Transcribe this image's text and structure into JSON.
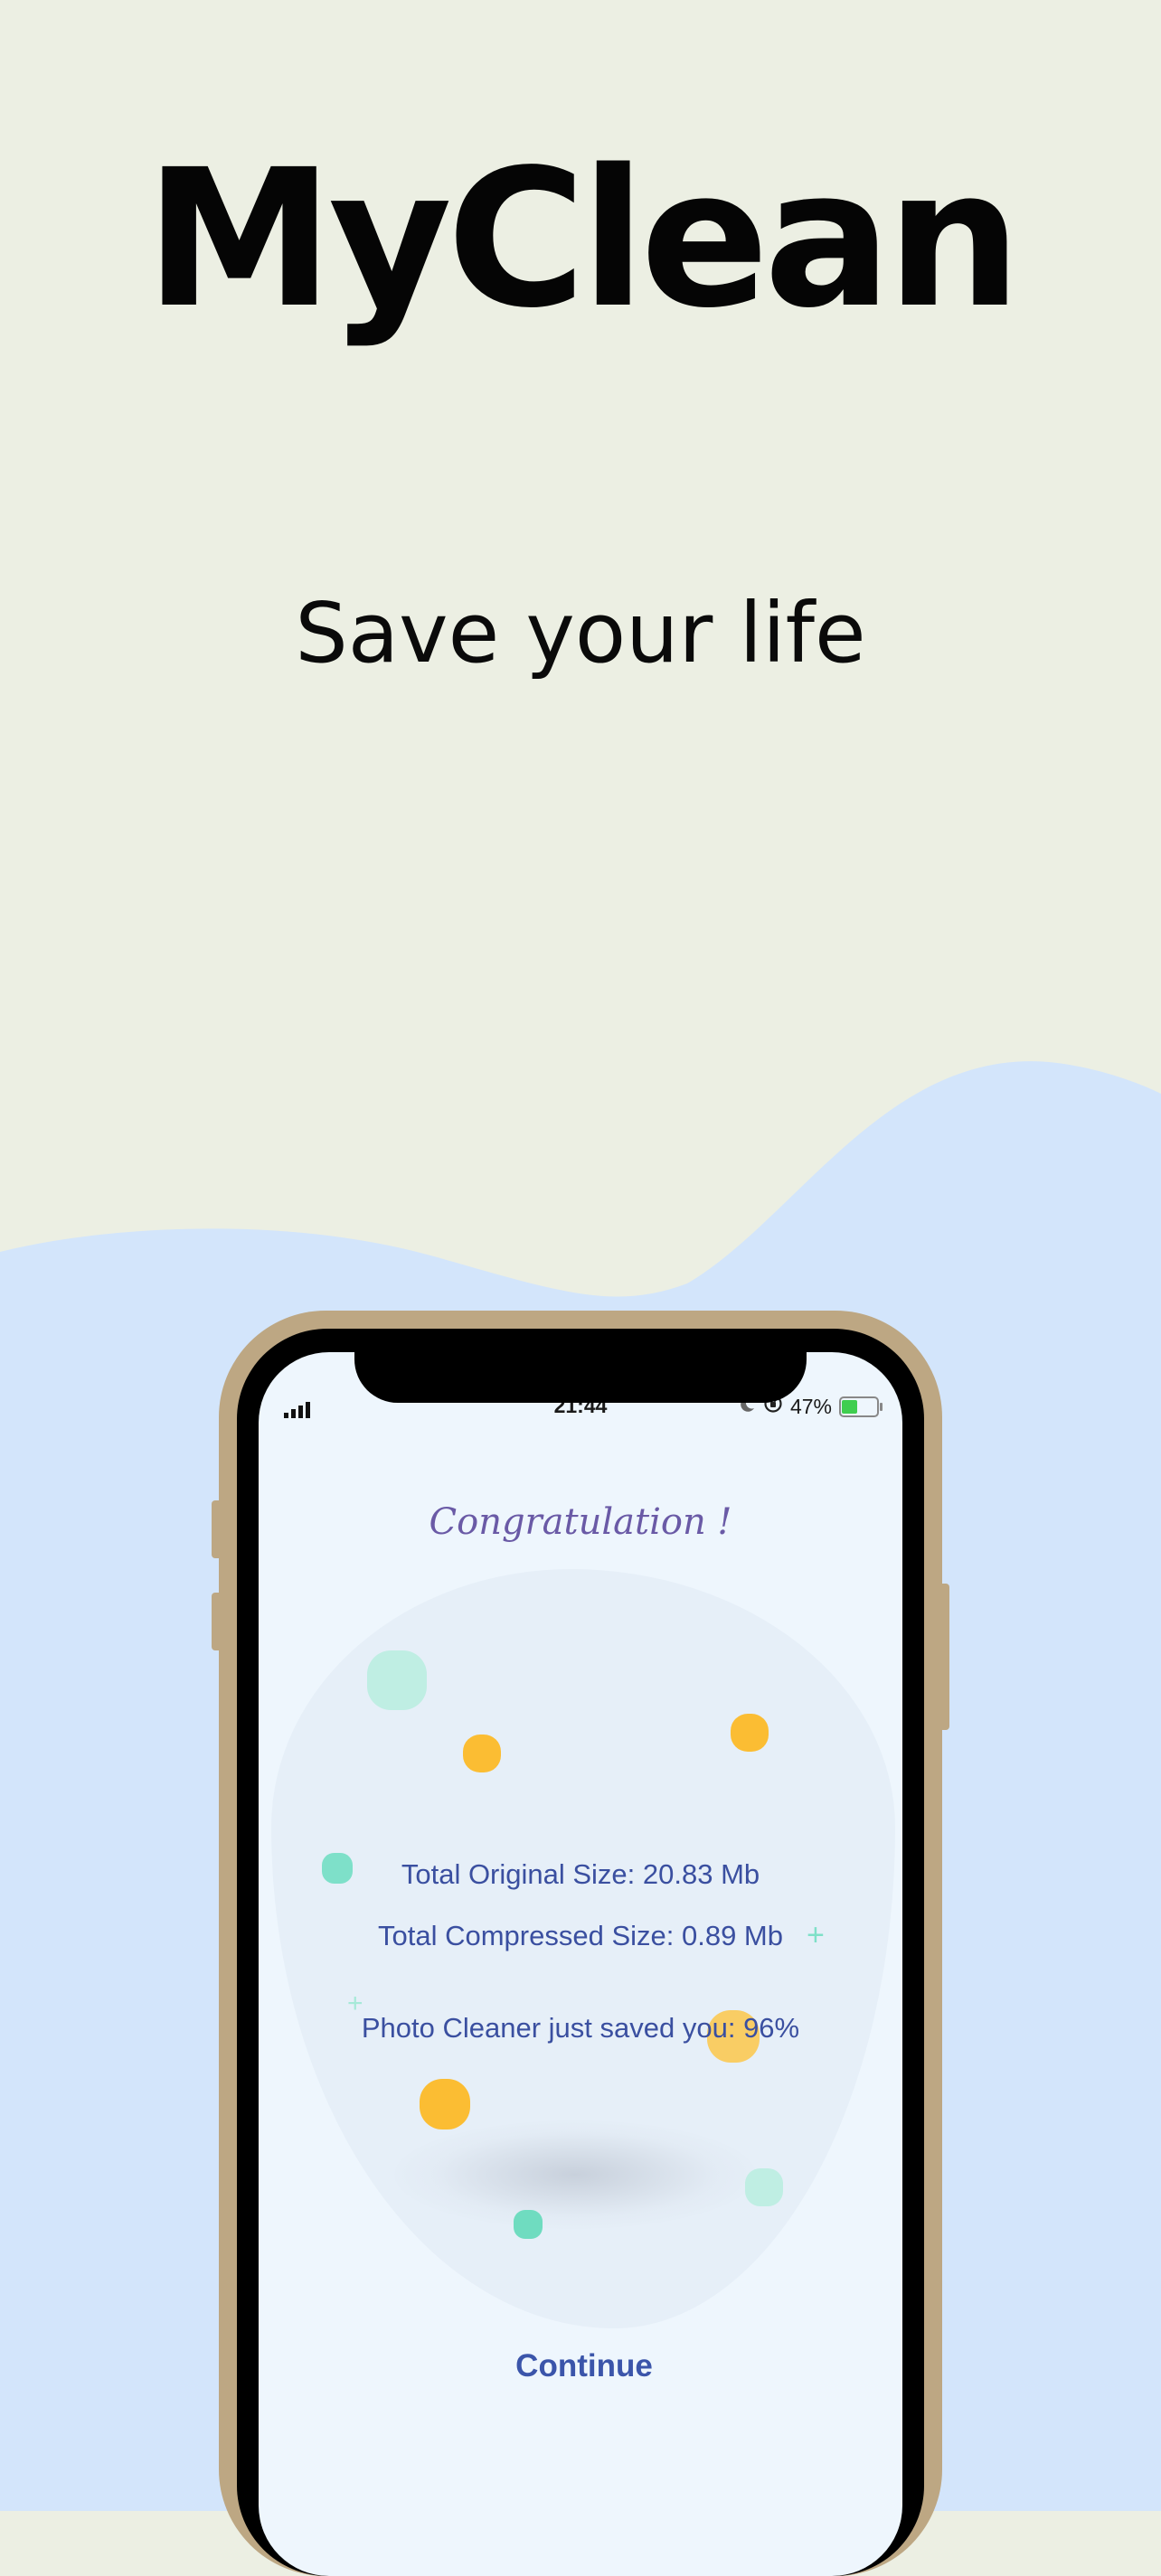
{
  "app_title": "MyClean",
  "tagline": "Save your life",
  "status_bar": {
    "time": "21:44",
    "battery_percent": "47%",
    "battery_level": 0.47,
    "icons": [
      "signal-icon",
      "moon-icon",
      "orientation-lock-icon",
      "battery-icon"
    ]
  },
  "result_screen": {
    "heading": "Congratulation !",
    "original_size": "Total Original Size: 20.83 Mb",
    "compressed_size": "Total Compressed Size: 0.89 Mb",
    "saved": "Photo Cleaner just saved you: 96%",
    "continue_label": "Continue"
  },
  "colors": {
    "background": "#ecefe3",
    "wave": "#d3e5fb",
    "phone_frame": "#bda783",
    "stat_text": "#3a4fa0",
    "accent_yellow": "#fbbd33",
    "accent_mint": "#6fdcc0"
  }
}
